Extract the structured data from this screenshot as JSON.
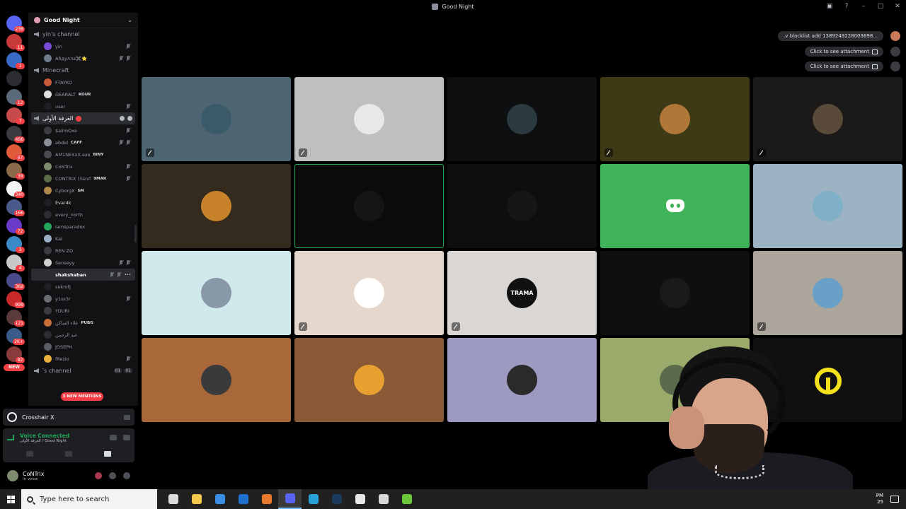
{
  "window": {
    "title": "Good Night"
  },
  "rail": {
    "badges": [
      "238",
      "11",
      "1",
      "",
      "12",
      "7",
      "466",
      "67",
      "39",
      "340",
      "166",
      "72",
      "3",
      "4",
      "362",
      "999",
      "121",
      "2K+",
      "82"
    ],
    "new_label": "NEW"
  },
  "sidebar": {
    "server_name": "Good Night",
    "channels": [
      {
        "name": "yin's channel",
        "users": [
          {
            "name": "yin",
            "tag": "",
            "color": "#7a4bd8"
          },
          {
            "name": "Абдулла✖️⭐",
            "tag": "",
            "color": "#6c7a8a"
          }
        ]
      },
      {
        "name": "Minecraft",
        "users": [
          {
            "name": "FTAYKO",
            "tag": "",
            "color": "#c85a3a"
          },
          {
            "name": "GEARALT",
            "tag": "KOUR",
            "color": "#e0e0e0"
          },
          {
            "name": "user",
            "tag": "",
            "color": "#1e1f22"
          }
        ]
      },
      {
        "name": "الغرفة الأولى",
        "users": [
          {
            "name": "$alimOxe",
            "tag": "",
            "color": "#3a3c42"
          },
          {
            "name": "abdel",
            "tag": "CAFF",
            "color": "#8a8f98"
          },
          {
            "name": "AM1NEXxX.exe",
            "tag": "BINY",
            "color": "#4a4b50"
          },
          {
            "name": "CoNTrix",
            "tag": "",
            "color": "#7d8a6d"
          },
          {
            "name": "CONTRIX (3anif",
            "tag": "9MAR",
            "color": "#5a6b4a"
          },
          {
            "name": "CyborgX",
            "tag": "GN",
            "color": "#b08a4a"
          },
          {
            "name": "Evar4k",
            "tag": "",
            "color": "#1e1f22"
          },
          {
            "name": "every_north",
            "tag": "",
            "color": "#2b2d31"
          },
          {
            "name": "iamsparadox",
            "tag": "",
            "color": "#23a55a"
          },
          {
            "name": "Kal",
            "tag": "",
            "color": "#9ab0c8"
          },
          {
            "name": "REN ZO",
            "tag": "",
            "color": "#3a3c42"
          },
          {
            "name": "Senseyy",
            "tag": "",
            "color": "#d0d0d0"
          },
          {
            "name": "shakshaban",
            "tag": "",
            "color": "#2b2d31"
          },
          {
            "name": "sekrofj",
            "tag": "",
            "color": "#1e1f22"
          },
          {
            "name": "y1ss3r",
            "tag": "",
            "color": "#6a6d74"
          },
          {
            "name": "YOURI",
            "tag": "",
            "color": "#3a3c42"
          },
          {
            "name": "علاء الساكن",
            "tag": "PUBG",
            "color": "#c8703a"
          },
          {
            "name": "عبد الرحمن",
            "tag": "",
            "color": "#2b2d31"
          },
          {
            "name": "JOSEPH",
            "tag": "",
            "color": "#5a5d64"
          },
          {
            "name": "fRezio",
            "tag": "",
            "color": "#e8b23a"
          }
        ]
      },
      {
        "name": "'s channel",
        "users": [],
        "counts": [
          "01",
          "01"
        ]
      }
    ],
    "new_mentions": "3 NEW MENTIONS"
  },
  "activity": {
    "name": "Crosshair X"
  },
  "voice": {
    "status": "Voice Connected",
    "location": "الغرفة الأولى / Good Night"
  },
  "user_panel": {
    "name": "CoNTrix",
    "status": "In voice"
  },
  "notifications": [
    {
      "text": ".v blacklist add 1389249228009898...",
      "attachment": false
    },
    {
      "text": "Click to see attachment",
      "attachment": true
    },
    {
      "text": "Click to see attachment",
      "attachment": true
    }
  ],
  "tiles": [
    {
      "bg": "#4d6570",
      "avatar": "#3a5a6a",
      "muted": true,
      "type": "avatar"
    },
    {
      "bg": "#bfbfbf",
      "avatar": "#e8e8e8",
      "muted": true,
      "type": "avatar"
    },
    {
      "bg": "#0d0f10",
      "avatar": "#2a3a3e",
      "muted": false,
      "type": "avatar"
    },
    {
      "bg": "#3e3a16",
      "avatar": "#b07838",
      "muted": true,
      "type": "avatar"
    },
    {
      "bg": "#1b1a18",
      "avatar": "#5a4a3a",
      "muted": true,
      "type": "avatar"
    },
    {
      "bg": "#342a1e",
      "avatar": "#c8822a",
      "muted": false,
      "type": "avatar"
    },
    {
      "bg": "#0a0b0b",
      "avatar": "#151515",
      "muted": false,
      "type": "avatar",
      "speaking": true
    },
    {
      "bg": "#0e0e0e",
      "avatar": "#161616",
      "muted": false,
      "type": "avatar"
    },
    {
      "bg": "#3fb35a",
      "avatar": "",
      "muted": false,
      "type": "discord"
    },
    {
      "bg": "#9bb3c2",
      "avatar": "#7fb0c8",
      "muted": false,
      "type": "avatar"
    },
    {
      "bg": "#cfe9ec",
      "avatar": "#8898a8",
      "muted": false,
      "type": "avatar"
    },
    {
      "bg": "#e6d7cc",
      "avatar": "#ffffff",
      "muted": true,
      "type": "avatar"
    },
    {
      "bg": "#d9d6d3",
      "avatar": "",
      "muted": true,
      "type": "trama",
      "label": "TRAMA"
    },
    {
      "bg": "#0f0f0f",
      "avatar": "#1a1a1a",
      "muted": false,
      "type": "avatar"
    },
    {
      "bg": "#aba59c",
      "avatar": "#6aa0c8",
      "muted": true,
      "type": "avatar"
    },
    {
      "bg": "#a8683a",
      "avatar": "#3a3a3a",
      "muted": false,
      "type": "avatar"
    },
    {
      "bg": "#8a5a36",
      "avatar": "#e8a030",
      "muted": false,
      "type": "avatar"
    },
    {
      "bg": "#9c9ac0",
      "avatar": "#2a2a2a",
      "muted": false,
      "type": "avatar"
    },
    {
      "bg": "#9aaa6a",
      "avatar": "#5a6a4a",
      "muted": false,
      "type": "avatar"
    },
    {
      "bg": "#101010",
      "avatar": "",
      "muted": false,
      "type": "ring"
    }
  ],
  "taskbar": {
    "search_placeholder": "Type here to search",
    "apps": [
      {
        "name": "task-view",
        "color": "#dbdbdb"
      },
      {
        "name": "file-explorer",
        "color": "#f4c84a"
      },
      {
        "name": "store",
        "color": "#3a8ee6"
      },
      {
        "name": "outlook",
        "color": "#1f6fd0"
      },
      {
        "name": "app-orange",
        "color": "#e8782a"
      },
      {
        "name": "discord",
        "color": "#5865f2"
      },
      {
        "name": "edge",
        "color": "#2aa0d8"
      },
      {
        "name": "steam",
        "color": "#1b3a5c"
      },
      {
        "name": "app-white",
        "color": "#e8e8e8"
      },
      {
        "name": "chrome",
        "color": "#d8d8d8"
      },
      {
        "name": "app-green",
        "color": "#6ac83a"
      }
    ],
    "time": "PM",
    "date": "25"
  }
}
